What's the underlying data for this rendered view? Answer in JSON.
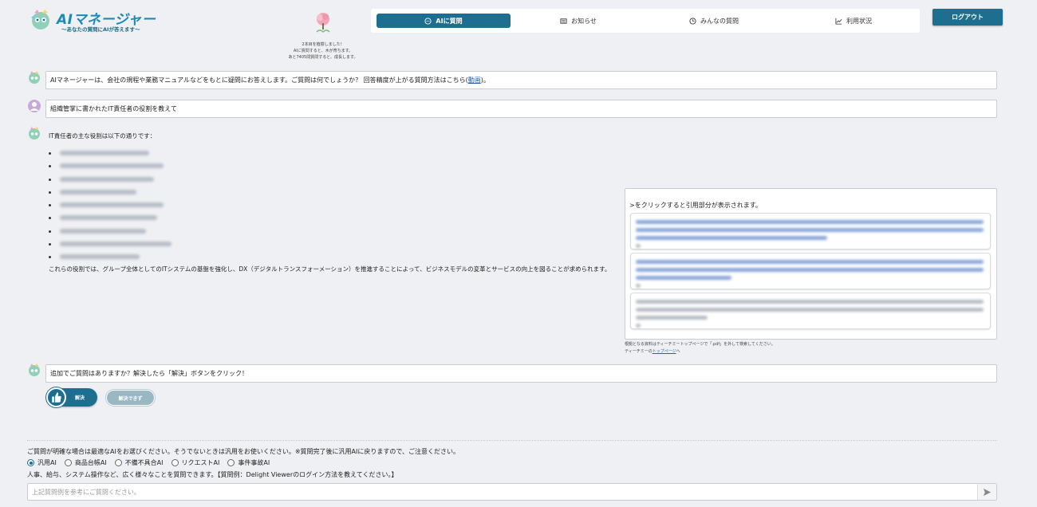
{
  "header": {
    "logo_title": "AIマネージャー",
    "logo_subtitle": "〜あなたの質問にAIが答えます〜",
    "tree_message": [
      "2本目を植樹しました！",
      "AIに質問すると、木が育ちます。",
      "あと7405問質問すると、成長します。"
    ],
    "nav": [
      {
        "label": "AIに質問",
        "icon": "chat-icon",
        "active": true
      },
      {
        "label": "お知らせ",
        "icon": "news-icon",
        "active": false
      },
      {
        "label": "みんなの質問",
        "icon": "clock-icon",
        "active": false
      },
      {
        "label": "利用状況",
        "icon": "chart-icon",
        "active": false
      }
    ],
    "logout_label": "ログアウト"
  },
  "chat": {
    "intro_text": "AIマネージャーは、会社の規程や業務マニュアルなどをもとに疑問にお答えします。ご質問は何でしょうか？ 回答精度が上がる質問方法はこちら(",
    "intro_link": "動画",
    "intro_end": ")。",
    "user_question": "組織管掌に書かれたIT責任者の役割を教えて",
    "answer_lead": "IT責任者の主な役割は以下の通りです：",
    "answer_conclusion": "これらの役割では、グループ全体としてのITシステムの基盤を強化し、DX（デジタルトランスフォーメーション）を推進することによって、ビジネスモデルの変革とサービスの向上を図ることが求められます。",
    "followup": "追加でご質問はありますか？解決したら「解決」ボタンをクリック！",
    "solved_label": "解決",
    "unsolved_label": "解決できず"
  },
  "citations": {
    "heading": ">をクリックすると引用部分が表示されます。",
    "note_line1": "根拠となる資料はティーチミートップページで「.pdf」を外して検索してください。",
    "note_line2_prefix": "ティーチミーの",
    "note_link": "トップページ",
    "note_line2_suffix": "へ"
  },
  "footer": {
    "notice": "ご質問が明確な場合は最適なAIをお選びください。そうでないときは汎用をお使いください。※質問完了後に汎用AIに戻りますので、ご注意ください。",
    "ai_options": [
      {
        "label": "汎用AI",
        "selected": true
      },
      {
        "label": "商品台帳AI",
        "selected": false
      },
      {
        "label": "不備不具合AI",
        "selected": false
      },
      {
        "label": "リクエストAI",
        "selected": false
      },
      {
        "label": "事件事故AI",
        "selected": false
      }
    ],
    "hint": "人事、給与、システム操作など、広く様々なことを質問できます。【質問例：Delight Viewerのログイン方法を教えてください。】",
    "input_placeholder": "上記質問例を参考にご質問ください。",
    "input_value": ""
  },
  "colors": {
    "primary": "#1e6f8f",
    "logo": "#1a8ab8",
    "background": "#eef0f3"
  }
}
